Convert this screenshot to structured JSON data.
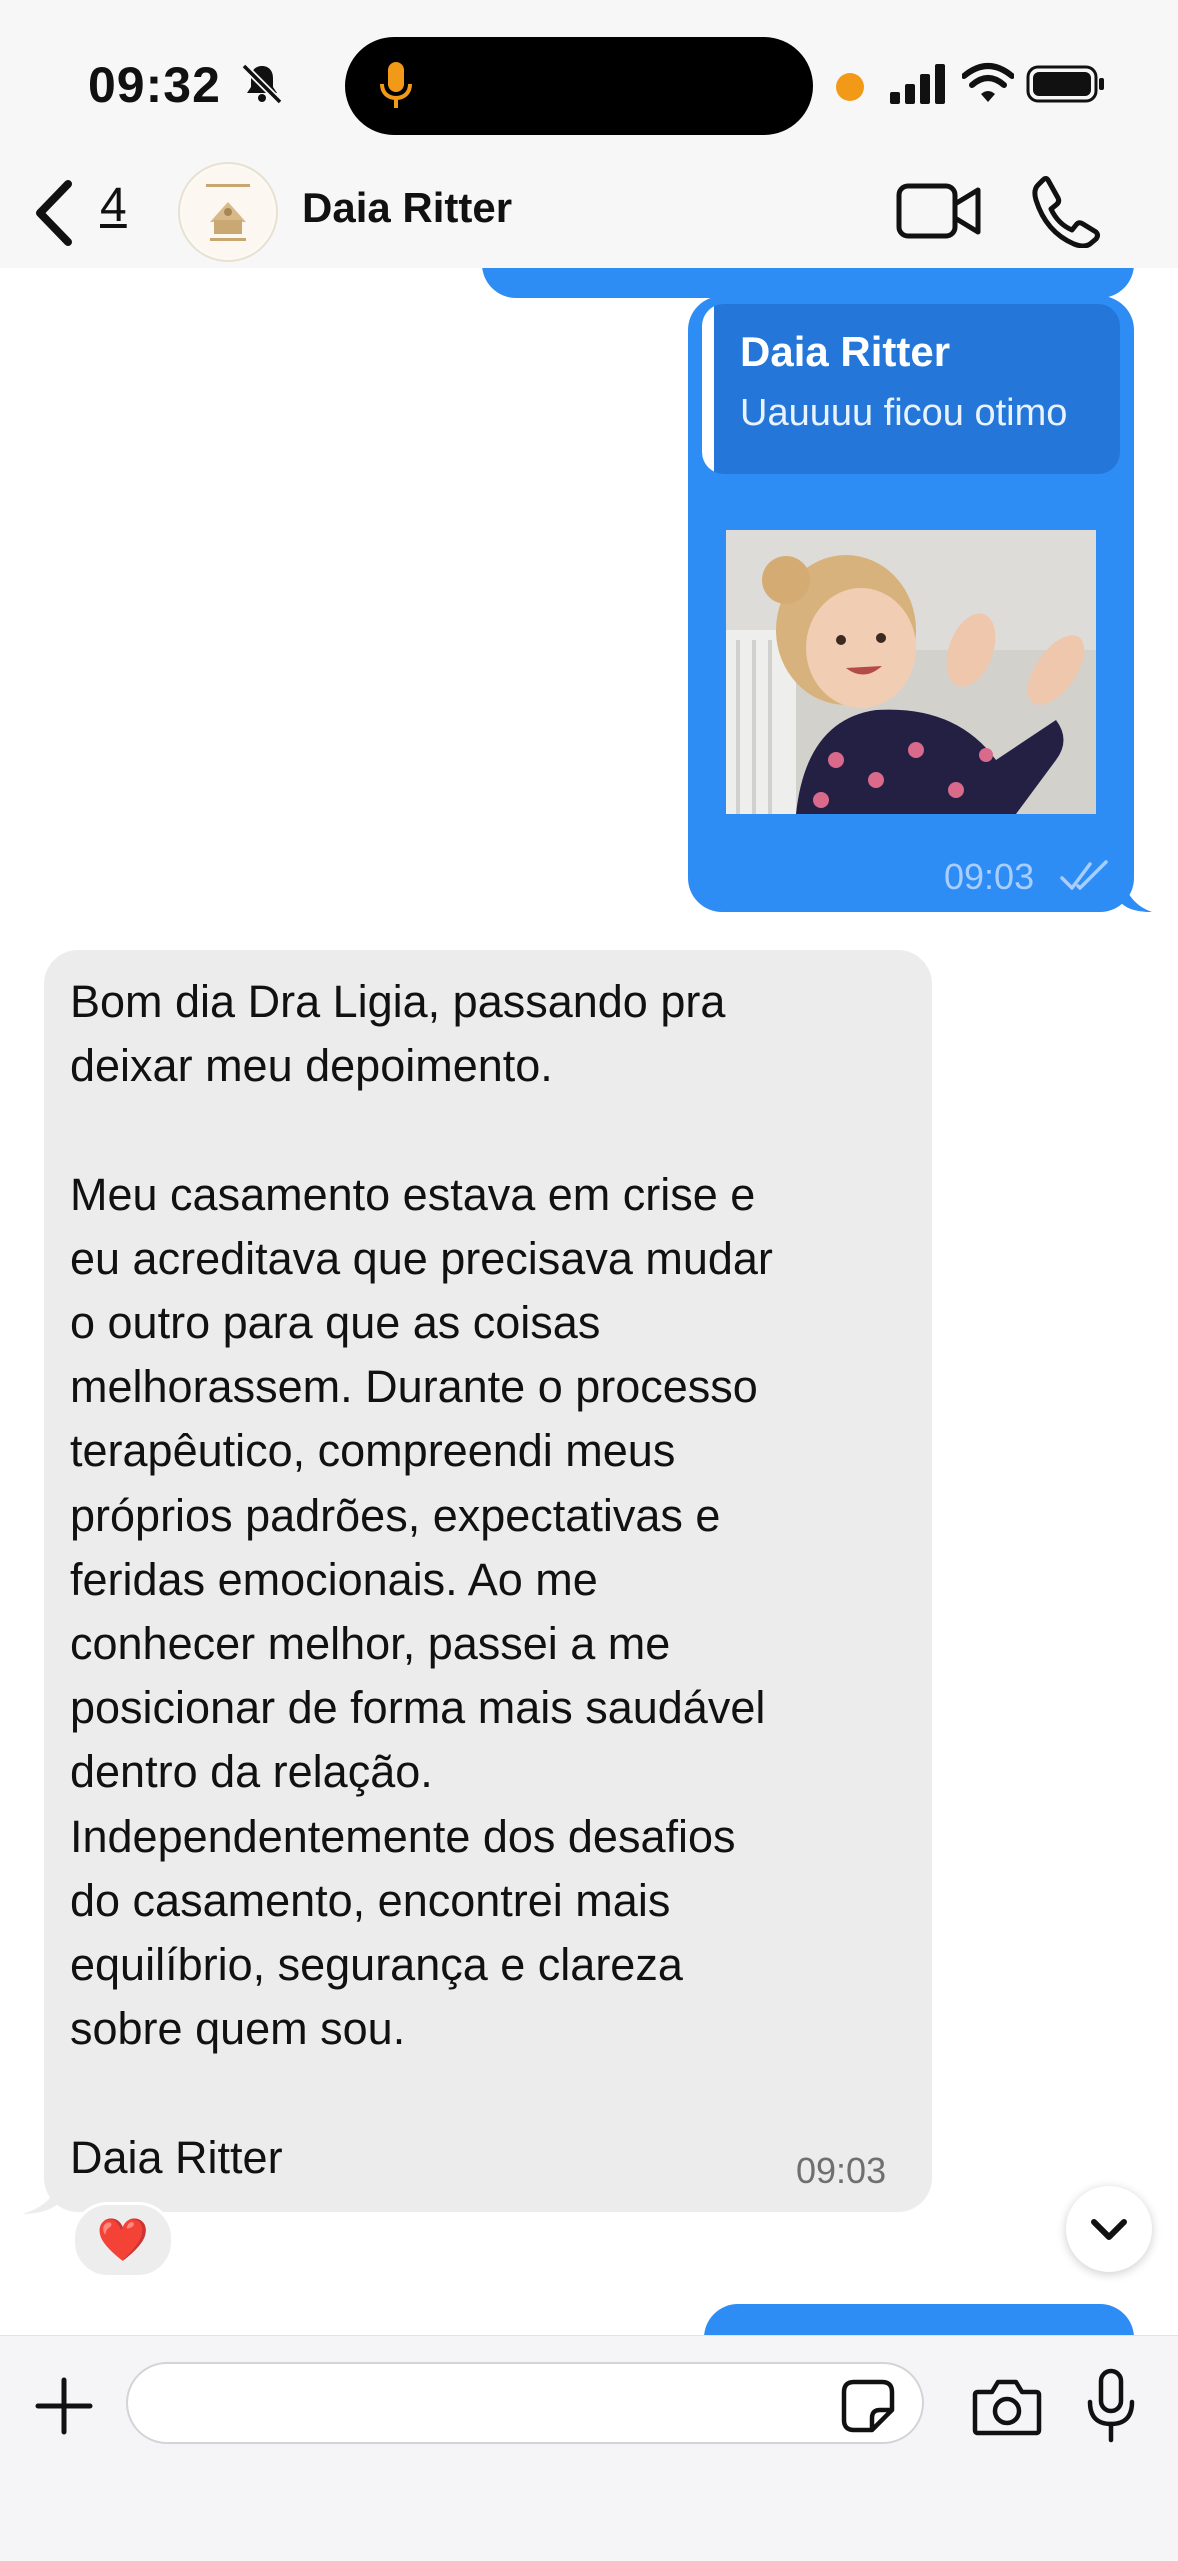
{
  "status_bar": {
    "time": "09:32",
    "bell_icon": "bell-slash-icon",
    "mic_indicator_icon": "microphone-icon",
    "colors": {
      "mic_indicator": "#f29a18",
      "recording_dot": "#f29a18"
    }
  },
  "header": {
    "back_icon": "chevron-left-icon",
    "unread_count": "4",
    "contact_name": "Daia Ritter",
    "video_call_icon": "video-camera-icon",
    "voice_call_icon": "phone-icon"
  },
  "messages": {
    "outgoing": {
      "reply_to_name": "Daia Ritter",
      "reply_to_text": "Uauuuu ficou otimo",
      "media_type": "gif",
      "time": "09:03",
      "status_icon": "double-check-icon",
      "color": "#2e8cf5"
    },
    "incoming": {
      "text": "Bom dia Dra Ligia, passando pra\ndeixar meu depoimento.\n\nMeu casamento estava em crise e\neu acreditava que precisava mudar\no outro para que as coisas\nmelhorassem. Durante o processo\nterapêutico, compreendi meus\npróprios padrões, expectativas e\nferidas emocionais. Ao me\nconhecer melhor, passei a me\nposicionar de forma mais saudável\ndentro da relação.\nIndependentemente dos desafios\ndo casamento, encontrei mais\nequilíbrio, segurança e clareza\nsobre quem sou.\n\nDaia Ritter",
      "time": "09:03",
      "reaction": "❤️",
      "color": "#ececec"
    }
  },
  "composer": {
    "placeholder": "",
    "plus_icon": "plus-icon",
    "sticker_icon": "sticker-icon",
    "camera_icon": "camera-icon",
    "mic_icon": "microphone-icon"
  }
}
